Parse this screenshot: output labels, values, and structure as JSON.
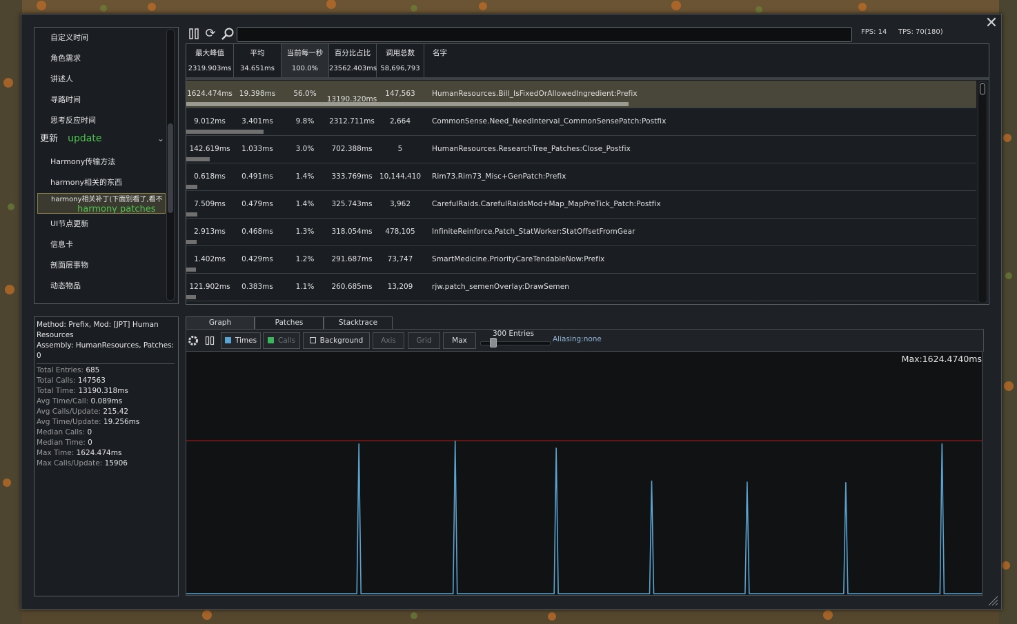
{
  "colors": {
    "accent_green": "#4ec44e",
    "times_series": "#5ba3d0",
    "calls_series": "#3cb45a",
    "max_line": "#c02020",
    "selected_row": "#49463a"
  },
  "categories": {
    "items_before": [
      "自定义时间",
      "角色需求",
      "讲述人",
      "寻路时间",
      "思考反应时间"
    ],
    "group": {
      "label": "更新",
      "label_en": "update",
      "icon": "chevron-down-icon"
    },
    "items_after": [
      "Harmony传输方法",
      "harmony相关的东西"
    ],
    "selected": {
      "label": "harmony相关补丁(下面别看了,看不懂的)",
      "label_en": "harmony patches"
    },
    "items_tail": [
      "UI节点更新",
      "信息卡",
      "剖面层事物",
      "动态物品"
    ]
  },
  "toolbar": {
    "pause_icon": "pause-icon",
    "refresh_icon": "refresh-icon",
    "search_icon": "search-icon",
    "search_value": "",
    "fps": "FPS: 14",
    "tps": "TPS: 70(180)"
  },
  "table": {
    "headers": [
      {
        "label": "最大峰值",
        "total": "2319.903ms"
      },
      {
        "label": "平均",
        "total": "34.651ms"
      },
      {
        "label": "当前每一秒",
        "total": "100.0%"
      },
      {
        "label": "百分比占比",
        "total": "23562.403ms"
      },
      {
        "label": "调用总数",
        "total": "58,696,793"
      },
      {
        "label": "名字",
        "total": ""
      }
    ],
    "rows": [
      {
        "max": "1624.474ms",
        "avg": "19.398ms",
        "percent": "56.0%",
        "total": "13190.320ms",
        "calls": "147,563",
        "name": "HumanResources.Bill_IsFixedOrAllowedIngredient:Prefix",
        "share": 0.56
      },
      {
        "max": "9.012ms",
        "avg": "3.401ms",
        "percent": "9.8%",
        "total": "2312.711ms",
        "calls": "2,664",
        "name": "CommonSense.Need_NeedInterval_CommonSensePatch:Postfix",
        "share": 0.098
      },
      {
        "max": "142.619ms",
        "avg": "1.033ms",
        "percent": "3.0%",
        "total": "702.388ms",
        "calls": "5",
        "name": "HumanResources.ResearchTree_Patches:Close_Postfix",
        "share": 0.03
      },
      {
        "max": "0.618ms",
        "avg": "0.491ms",
        "percent": "1.4%",
        "total": "333.769ms",
        "calls": "10,144,410",
        "name": "Rim73.Rim73_Misc+GenPatch:Prefix",
        "share": 0.014
      },
      {
        "max": "7.509ms",
        "avg": "0.479ms",
        "percent": "1.4%",
        "total": "325.743ms",
        "calls": "3,962",
        "name": "CarefulRaids.CarefulRaidsMod+Map_MapPreTick_Patch:Postfix",
        "share": 0.014
      },
      {
        "max": "2.913ms",
        "avg": "0.468ms",
        "percent": "1.3%",
        "total": "318.054ms",
        "calls": "478,105",
        "name": "InfiniteReinforce.Patch_StatWorker:StatOffsetFromGear",
        "share": 0.013
      },
      {
        "max": "1.402ms",
        "avg": "0.429ms",
        "percent": "1.2%",
        "total": "291.687ms",
        "calls": "73,747",
        "name": "SmartMedicine.PriorityCareTendableNow:Prefix",
        "share": 0.012
      },
      {
        "max": "121.902ms",
        "avg": "0.383ms",
        "percent": "1.1%",
        "total": "260.685ms",
        "calls": "13,209",
        "name": "rjw.patch_semenOverlay:DrawSemen",
        "share": 0.011
      }
    ]
  },
  "info": {
    "header": "Method: Prefix, Mod: [JPT] Human Resources\nAssembly: HumanResources, Patches: 0",
    "stats": [
      {
        "label": "Total Entries:",
        "value": "685"
      },
      {
        "label": "Total Calls:",
        "value": "147563"
      },
      {
        "label": "Total Time:",
        "value": "13190.318ms"
      },
      {
        "label": "Avg Time/Call:",
        "value": "0.089ms"
      },
      {
        "label": "Avg Calls/Update:",
        "value": "215.42"
      },
      {
        "label": "Avg Time/Update:",
        "value": "19.256ms"
      },
      {
        "label": "Median Calls:",
        "value": "0"
      },
      {
        "label": "Median Time:",
        "value": "0"
      },
      {
        "label": "Max Time:",
        "value": "1624.474ms"
      },
      {
        "label": "Max Calls/Update:",
        "value": "15906"
      }
    ]
  },
  "tabs": [
    "Graph",
    "Patches",
    "Stacktrace"
  ],
  "graph_toolbar": {
    "settings_icon": "gear-icon",
    "columns_icon": "columns-icon",
    "times": "Times",
    "calls": "Calls",
    "background": "Background",
    "axis": "Axis",
    "grid": "Grid",
    "max": "Max",
    "entries": "300 Entries",
    "entries_level": 0.05,
    "aliasing": "Aliasing:none"
  },
  "chart_data": {
    "type": "line",
    "series": [
      {
        "name": "Times",
        "spikes": [
          {
            "x": 0.217,
            "y": 1595
          },
          {
            "x": 0.338,
            "y": 1624.474
          },
          {
            "x": 0.465,
            "y": 1550
          },
          {
            "x": 0.585,
            "y": 1200
          },
          {
            "x": 0.705,
            "y": 1190
          },
          {
            "x": 0.829,
            "y": 1185
          },
          {
            "x": 0.95,
            "y": 1595
          }
        ]
      }
    ],
    "max_label": "Max:1624.4740ms",
    "max_value": 1624.474,
    "ylim": [
      0,
      2000
    ]
  }
}
